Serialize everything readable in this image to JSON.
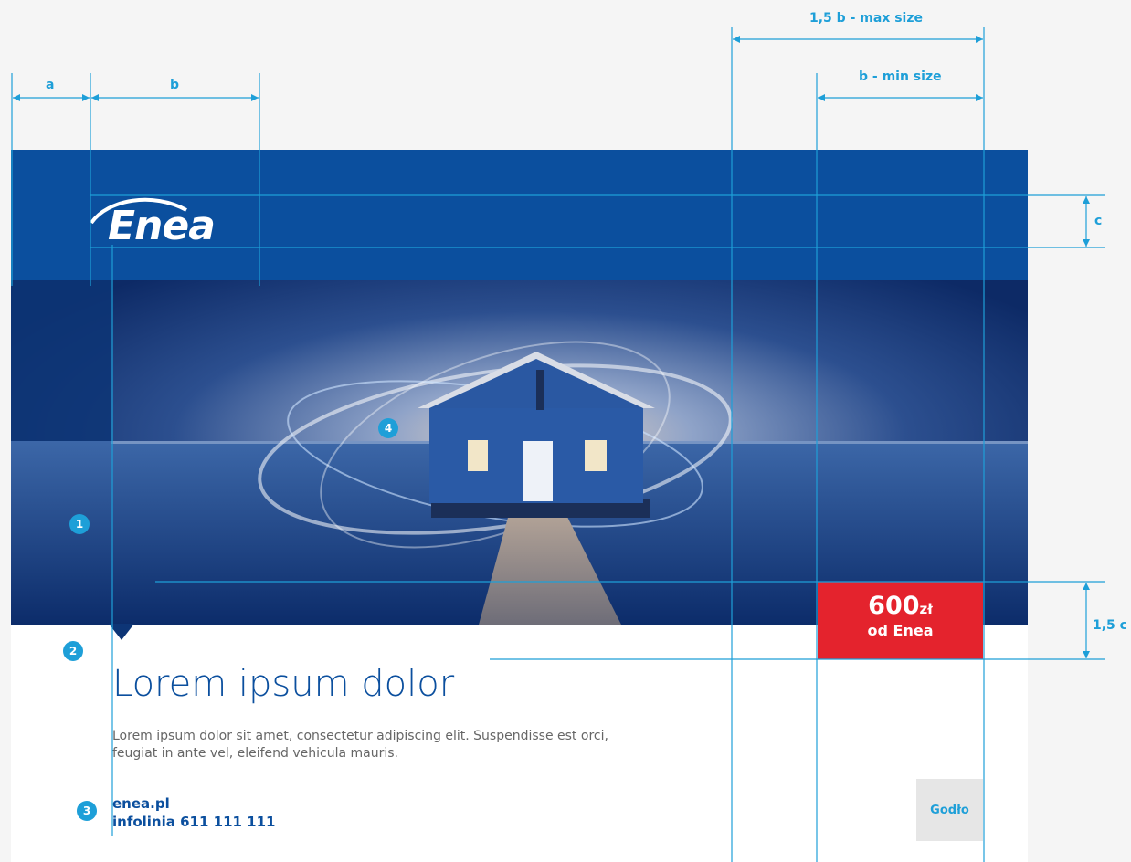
{
  "logo": {
    "text": "Enea"
  },
  "hero": {
    "subject": "blue boathouse on stilts with pier over water at dusk with light swirl"
  },
  "dimensions": {
    "a": "a",
    "b": "b",
    "max": "1,5 b - max size",
    "min": "b - min size",
    "c": "c",
    "c15": "1,5 c"
  },
  "markers": [
    "1",
    "2",
    "3",
    "4"
  ],
  "content": {
    "headline": "Lorem ipsum dolor",
    "body": "Lorem ipsum dolor sit amet, consectetur adipiscing elit. Suspendisse est orci, feugiat in ante vel, eleifend vehicula mauris.",
    "website": "enea.pl",
    "hotline": "infolinia 611 111 111"
  },
  "price_badge": {
    "amount": "600",
    "currency": "zł",
    "subtitle": "od Enea"
  },
  "emblem": {
    "label": "Godło"
  },
  "colors": {
    "brand_blue": "#0b4f9e",
    "guide_cyan": "#1e9fd8",
    "badge_red": "#e4232d"
  }
}
